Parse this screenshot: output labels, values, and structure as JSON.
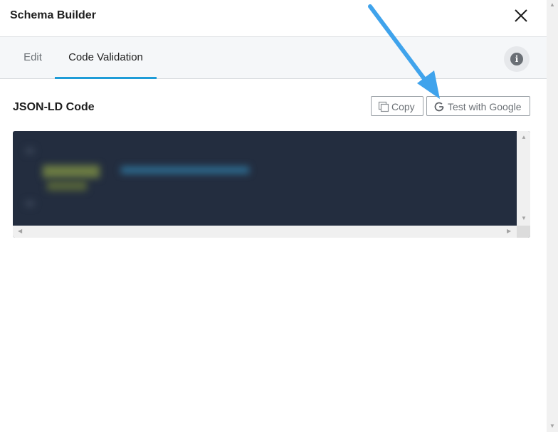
{
  "modal": {
    "title": "Schema Builder",
    "close_icon": "close-icon"
  },
  "tabs": [
    {
      "label": "Edit",
      "active": false
    },
    {
      "label": "Code Validation",
      "active": true
    }
  ],
  "info_icon": "info-icon",
  "section": {
    "title": "JSON-LD Code",
    "copy_label": "Copy",
    "copy_icon": "copy-icon",
    "test_label": "Test with Google",
    "test_icon": "google-g-icon"
  },
  "code_box": {
    "content_state": "blurred",
    "background": "#232d3f"
  },
  "colors": {
    "accent": "#1e9cd7",
    "annotation_arrow": "#3fa3ec"
  }
}
